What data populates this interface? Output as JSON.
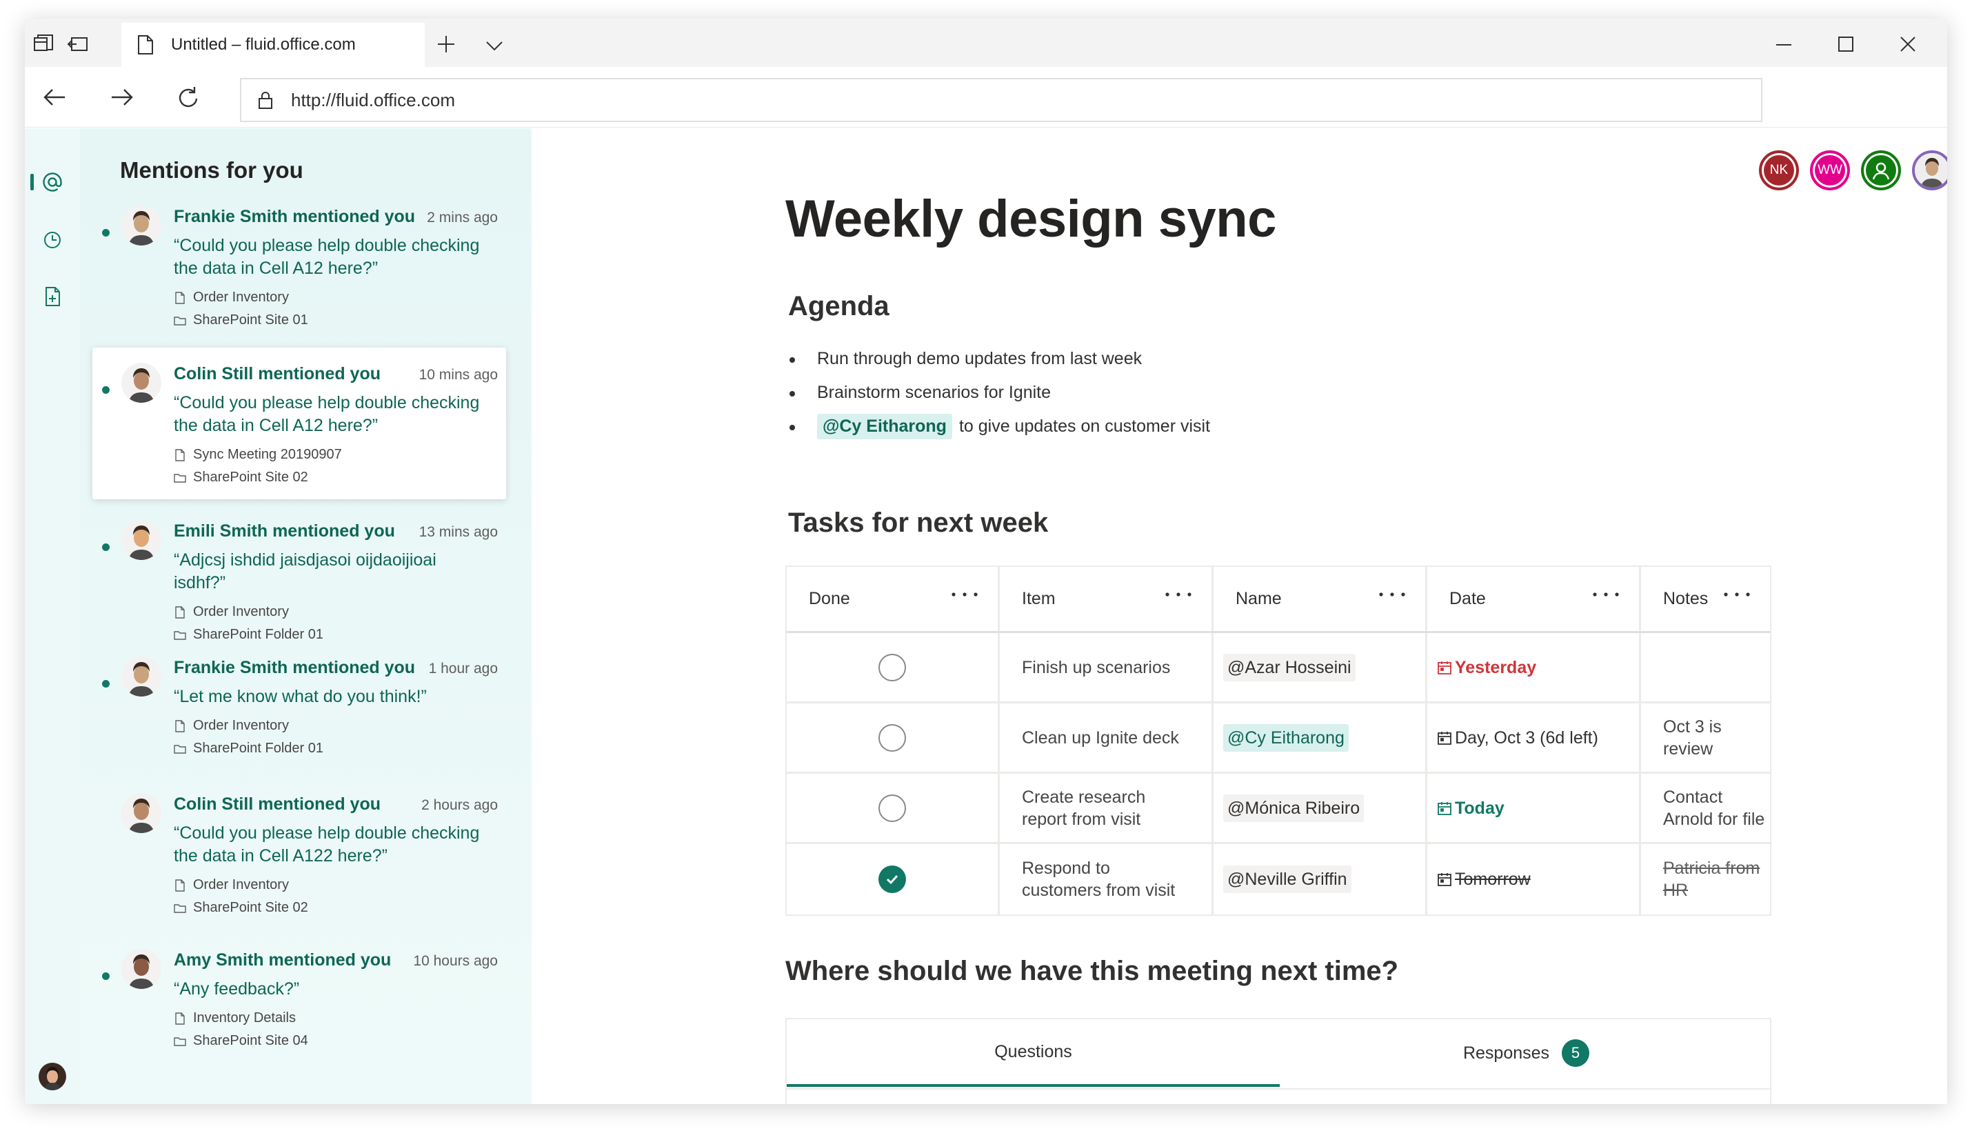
{
  "browser": {
    "tab_title": "Untitled – fluid.office.com",
    "url": "http://fluid.office.com"
  },
  "mentions": {
    "title": "Mentions for you",
    "items": [
      {
        "who": "Frankie Smith mentioned you",
        "time": "2 mins ago",
        "quote": "“Could you please help double checking the data in Cell A12 here?”",
        "file": "Order Inventory",
        "location": "SharePoint Site 01",
        "unread": true
      },
      {
        "who": "Colin Still mentioned you",
        "time": "10 mins ago",
        "quote": "“Could you please help double checking the data in Cell A12 here?”",
        "file": "Sync Meeting 20190907",
        "location": "SharePoint Site 02",
        "unread": true
      },
      {
        "who": "Emili Smith mentioned you",
        "time": "13 mins ago",
        "quote": "“Adjcsj ishdid jaisdjasoi oijdaoijioai isdhf?”",
        "file": "Order Inventory",
        "location": "SharePoint Folder 01",
        "unread": true
      },
      {
        "who": "Frankie Smith mentioned you",
        "time": "1 hour ago",
        "quote": "“Let me know what do you think!”",
        "file": "Order Inventory",
        "location": "SharePoint Folder 01",
        "unread": true
      },
      {
        "who": "Colin Still mentioned you",
        "time": "2 hours ago",
        "quote": "“Could you please help double checking the data in Cell A122 here?”",
        "file": "Order Inventory",
        "location": "SharePoint Site 02",
        "unread": false
      },
      {
        "who": "Amy Smith mentioned you",
        "time": "10 hours ago",
        "quote": "“Any feedback?”",
        "file": "Inventory Details",
        "location": "SharePoint Site 04",
        "unread": true
      }
    ]
  },
  "collaborators": [
    {
      "initials": "NK",
      "color": "#a4262c"
    },
    {
      "initials": "WW",
      "color": "#e3008c"
    },
    {
      "initials": "",
      "color": "#107c10",
      "icon": "person-icon"
    },
    {
      "initials": "",
      "color": "#8764b8",
      "icon": "photo-avatar"
    }
  ],
  "doc": {
    "title": "Weekly design sync",
    "agenda_heading": "Agenda",
    "agenda": [
      {
        "text": "Run through demo updates from last week"
      },
      {
        "text": "Brainstorm scenarios for Ignite"
      },
      {
        "mention": "@Cy Eitharong",
        "text": "to give updates on customer visit"
      }
    ],
    "tasks_heading": "Tasks for next week",
    "columns": [
      "Done",
      "Item",
      "Name",
      "Date",
      "Notes"
    ],
    "rows": [
      {
        "done": false,
        "item": "Finish up scenarios",
        "name": "@Azar Hosseini",
        "date": "Yesterday",
        "date_style": "overdue",
        "notes": ""
      },
      {
        "done": false,
        "item": "Clean up Ignite deck",
        "name": "@Cy Eitharong",
        "date": "Day, Oct 3 (6d left)",
        "date_style": "normal",
        "notes": "Oct 3 is review"
      },
      {
        "done": false,
        "item": "Create research report from visit",
        "name": "@Mónica Ribeiro",
        "date": "Today",
        "date_style": "today",
        "notes": "Contact Arnold for file"
      },
      {
        "done": true,
        "item": "Respond to customers from visit",
        "name": "@Neville Griffin",
        "date": "Tomorrow",
        "date_style": "done",
        "notes": "Patricia from HR"
      }
    ],
    "poll_heading": "Where should we have this meeting next time?",
    "poll_tabs": {
      "questions": "Questions",
      "responses": "Responses",
      "responses_count": "5"
    }
  },
  "colors": {
    "accent": "#117865",
    "overdue": "#d13438"
  }
}
